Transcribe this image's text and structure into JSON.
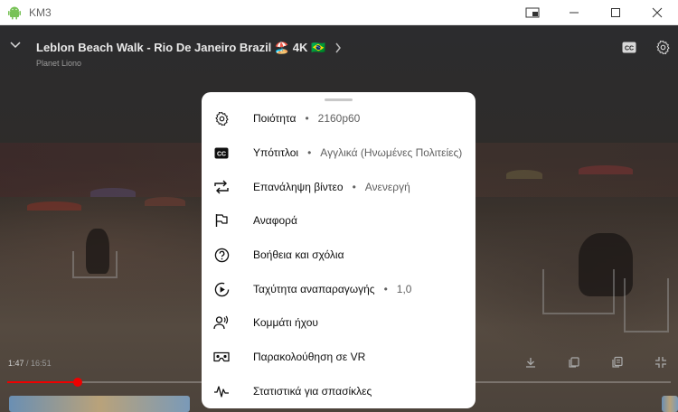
{
  "window": {
    "app_title": "KM3",
    "controls": [
      "picture-in-picture-icon",
      "minimize-icon",
      "maximize-icon",
      "close-icon"
    ]
  },
  "video": {
    "title": "Leblon Beach Walk - Rio De Janeiro Brazil 🏖️ 4K 🇧🇷",
    "channel": "Planet Liono",
    "current_time": "1:47",
    "separator": " / ",
    "duration": "16:51",
    "progress_fraction": 0.106
  },
  "settings_menu": {
    "items": [
      {
        "icon": "gear-icon",
        "label": "Ποιότητα",
        "value": "2160p60"
      },
      {
        "icon": "closed-captions-icon",
        "label": "Υπότιτλοι",
        "value": "Αγγλικά (Ηνωμένες Πολιτείες)"
      },
      {
        "icon": "repeat-icon",
        "label": "Επανάληψη βίντεο",
        "value": "Ανενεργή"
      },
      {
        "icon": "flag-icon",
        "label": "Αναφορά",
        "value": ""
      },
      {
        "icon": "help-icon",
        "label": "Βοήθεια και σχόλια",
        "value": ""
      },
      {
        "icon": "playback-speed-icon",
        "label": "Ταχύτητα αναπαραγωγής",
        "value": "1,0"
      },
      {
        "icon": "audio-track-icon",
        "label": "Κομμάτι ήχου",
        "value": ""
      },
      {
        "icon": "vr-headset-icon",
        "label": "Παρακολούθηση σε VR",
        "value": ""
      },
      {
        "icon": "stats-icon",
        "label": "Στατιστικά για σπασίκλες",
        "value": ""
      }
    ]
  },
  "colors": {
    "progress": "#ee0000",
    "sheet_bg": "#ffffff",
    "app_icon": "#78c257"
  }
}
